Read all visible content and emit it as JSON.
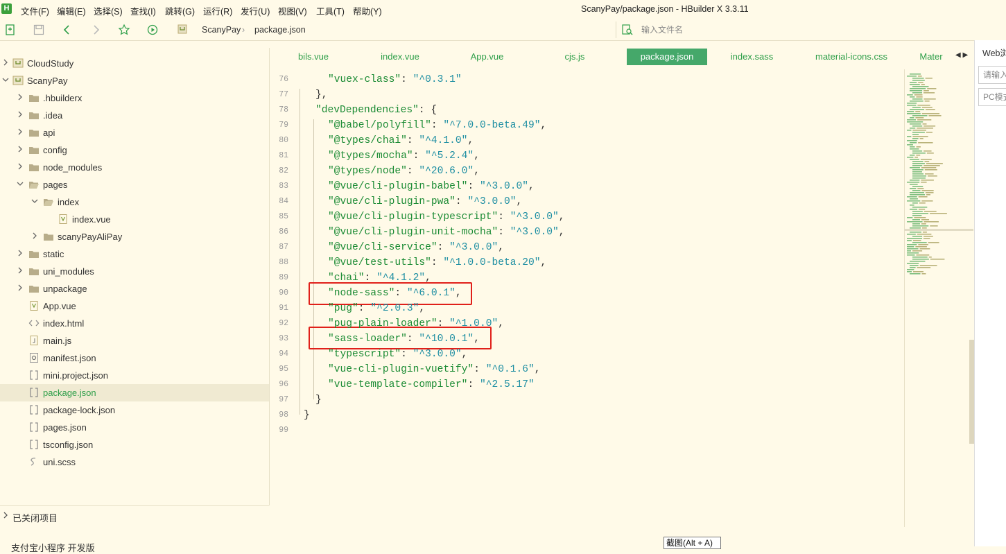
{
  "app": {
    "logo_letter": "H",
    "window_title": "ScanyPay/package.json - HBuilder X 3.3.11",
    "menu": [
      "文件(F)",
      "编辑(E)",
      "选择(S)",
      "查找(I)",
      "跳转(G)",
      "运行(R)",
      "发行(U)",
      "视图(V)",
      "工具(T)",
      "帮助(Y)"
    ]
  },
  "toolbar": {
    "breadcrumb": [
      "ScanyPay",
      "package.json"
    ],
    "file_search_placeholder": "输入文件名"
  },
  "sidebar": {
    "tree": [
      {
        "label": "CloudStudy",
        "icon": "project-icon",
        "chevron": "right"
      },
      {
        "label": "ScanyPay",
        "icon": "project-icon",
        "chevron": "down"
      },
      {
        "label": ".hbuilderx",
        "icon": "folder-icon",
        "chevron": "right"
      },
      {
        "label": ".idea",
        "icon": "folder-icon",
        "chevron": "right"
      },
      {
        "label": "api",
        "icon": "folder-icon",
        "chevron": "right"
      },
      {
        "label": "config",
        "icon": "folder-icon",
        "chevron": "right"
      },
      {
        "label": "node_modules",
        "icon": "folder-icon",
        "chevron": "right"
      },
      {
        "label": "pages",
        "icon": "folder-open-icon",
        "chevron": "down"
      },
      {
        "label": "index",
        "icon": "folder-open-icon",
        "chevron": "down"
      },
      {
        "label": "index.vue",
        "icon": "vue-file-icon",
        "chevron": "none"
      },
      {
        "label": "scanyPayAliPay",
        "icon": "folder-icon",
        "chevron": "right"
      },
      {
        "label": "static",
        "icon": "folder-icon",
        "chevron": "right"
      },
      {
        "label": "uni_modules",
        "icon": "folder-icon",
        "chevron": "right"
      },
      {
        "label": "unpackage",
        "icon": "folder-icon",
        "chevron": "right"
      },
      {
        "label": "App.vue",
        "icon": "vue-file-icon",
        "chevron": "none"
      },
      {
        "label": "index.html",
        "icon": "html-file-icon",
        "chevron": "none"
      },
      {
        "label": "main.js",
        "icon": "js-file-icon",
        "chevron": "none"
      },
      {
        "label": "manifest.json",
        "icon": "manifest-file-icon",
        "chevron": "none"
      },
      {
        "label": "mini.project.json",
        "icon": "json-file-icon",
        "chevron": "none"
      },
      {
        "label": "package.json",
        "icon": "json-file-icon",
        "chevron": "none",
        "selected": true
      },
      {
        "label": "package-lock.json",
        "icon": "json-file-icon",
        "chevron": "none"
      },
      {
        "label": "pages.json",
        "icon": "json-file-icon",
        "chevron": "none"
      },
      {
        "label": "tsconfig.json",
        "icon": "json-file-icon",
        "chevron": "none"
      },
      {
        "label": "uni.scss",
        "icon": "scss-file-icon",
        "chevron": "none"
      }
    ],
    "closed_projects_label": "已关闭项目",
    "bottom_cut_text": "支付宝小程序 开发版"
  },
  "tabs": [
    {
      "label": "bils.vue"
    },
    {
      "label": "index.vue"
    },
    {
      "label": "App.vue"
    },
    {
      "label": "cjs.js"
    },
    {
      "label": "package.json",
      "active": true
    },
    {
      "label": "index.sass"
    },
    {
      "label": "material-icons.css"
    },
    {
      "label": "Mater"
    }
  ],
  "tab_scroll_arrows": "◀ ▶",
  "editor": {
    "lines": [
      {
        "n": "76",
        "key": "\"vuex-class\"",
        "val": "\"^0.3.1\"",
        "end": ""
      },
      {
        "n": "77",
        "text": "},"
      },
      {
        "n": "78",
        "key": "\"devDependencies\"",
        "open": "{"
      },
      {
        "n": "79",
        "key": "\"@babel/polyfill\"",
        "val": "\"^7.0.0-beta.49\"",
        "end": ","
      },
      {
        "n": "80",
        "key": "\"@types/chai\"",
        "val": "\"^4.1.0\"",
        "end": ","
      },
      {
        "n": "81",
        "key": "\"@types/mocha\"",
        "val": "\"^5.2.4\"",
        "end": ","
      },
      {
        "n": "82",
        "key": "\"@types/node\"",
        "val": "\"^20.6.0\"",
        "end": ","
      },
      {
        "n": "83",
        "key": "\"@vue/cli-plugin-babel\"",
        "val": "\"^3.0.0\"",
        "end": ","
      },
      {
        "n": "84",
        "key": "\"@vue/cli-plugin-pwa\"",
        "val": "\"^3.0.0\"",
        "end": ","
      },
      {
        "n": "85",
        "key": "\"@vue/cli-plugin-typescript\"",
        "val": "\"^3.0.0\"",
        "end": ","
      },
      {
        "n": "86",
        "key": "\"@vue/cli-plugin-unit-mocha\"",
        "val": "\"^3.0.0\"",
        "end": ","
      },
      {
        "n": "87",
        "key": "\"@vue/cli-service\"",
        "val": "\"^3.0.0\"",
        "end": ","
      },
      {
        "n": "88",
        "key": "\"@vue/test-utils\"",
        "val": "\"^1.0.0-beta.20\"",
        "end": ","
      },
      {
        "n": "89",
        "key": "\"chai\"",
        "val": "\"^4.1.2\"",
        "end": ","
      },
      {
        "n": "90",
        "key": "\"node-sass\"",
        "val": "\"^6.0.1\"",
        "end": ","
      },
      {
        "n": "91",
        "key": "\"pug\"",
        "val": "\"^2.0.3\"",
        "end": ","
      },
      {
        "n": "92",
        "key": "\"pug-plain-loader\"",
        "val": "\"^1.0.0\"",
        "end": ","
      },
      {
        "n": "93",
        "key": "\"sass-loader\"",
        "val": "\"^10.0.1\"",
        "end": ","
      },
      {
        "n": "94",
        "key": "\"typescript\"",
        "val": "\"^3.0.0\"",
        "end": ","
      },
      {
        "n": "95",
        "key": "\"vue-cli-plugin-vuetify\"",
        "val": "\"^0.1.6\"",
        "end": ","
      },
      {
        "n": "96",
        "key": "\"vue-template-compiler\"",
        "val": "\"^2.5.17\"",
        "end": ""
      },
      {
        "n": "97",
        "text": "}"
      },
      {
        "n": "98",
        "text": "}"
      },
      {
        "n": "99",
        "text": ""
      }
    ]
  },
  "right_panel": {
    "title": "Web浏",
    "input_placeholder": "请输入",
    "mode_label": "PC模式"
  },
  "screenshot_tip": "截图(Alt + A)",
  "colors": {
    "background": "#fffae8",
    "accent_green": "#45a86a",
    "json_key": "#1b8b34",
    "json_value": "#1f8fa3",
    "highlight_box": "#e0201a"
  }
}
